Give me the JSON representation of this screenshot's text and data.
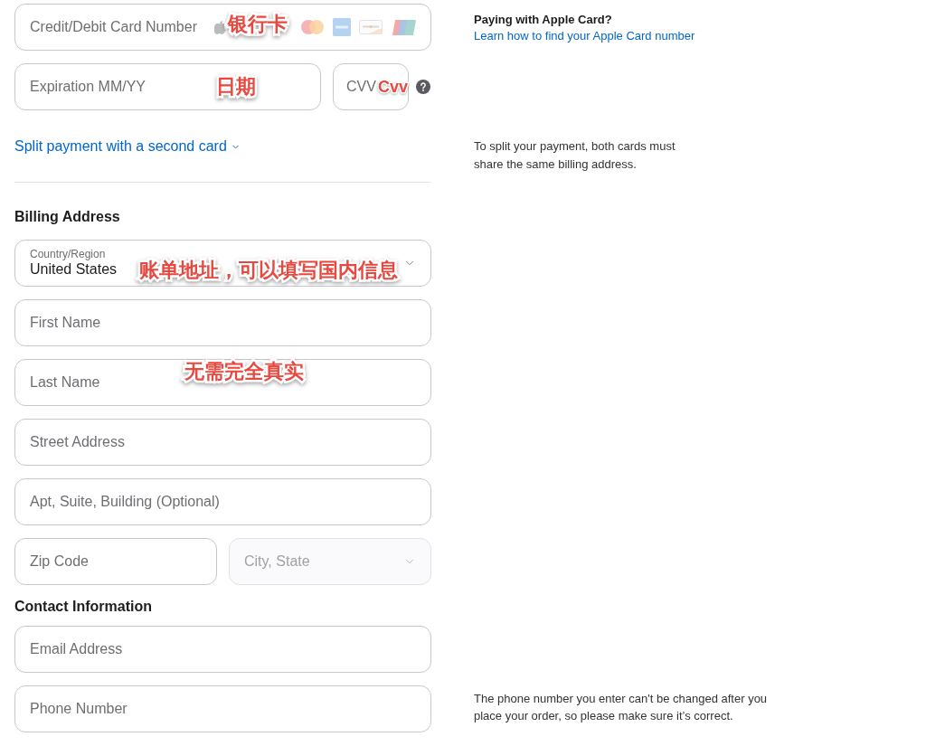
{
  "card_section": {
    "card_number": {
      "placeholder": "Credit/Debit Card Number",
      "annotation": "银行卡"
    },
    "apple_card": {
      "title": "Paying with Apple Card?",
      "link": "Learn how to find your Apple Card number"
    },
    "expiration": {
      "placeholder": "Expiration MM/YY",
      "annotation": "日期"
    },
    "cvv": {
      "placeholder": "CVV",
      "annotation": "Cvv"
    },
    "split_link": "Split payment with a second card",
    "split_note": "To split your payment, both cards must share the same billing address."
  },
  "billing_address": {
    "title": "Billing Address",
    "rows": [
      [
        {
          "kind": "select",
          "label": "Country/Region",
          "value": "United States",
          "disabled": false,
          "annotation": "账单地址，可以填写国内信息"
        }
      ],
      [
        {
          "kind": "input",
          "placeholder": "First Name",
          "disabled": false
        }
      ],
      [
        {
          "kind": "input",
          "placeholder": "Last Name",
          "disabled": false,
          "annotation": "无需完全真实"
        }
      ],
      [
        {
          "kind": "input",
          "placeholder": "Street Address",
          "disabled": false
        }
      ],
      [
        {
          "kind": "input",
          "placeholder": "Apt, Suite, Building (Optional)",
          "disabled": false
        }
      ],
      [
        {
          "kind": "input",
          "placeholder": "Zip Code",
          "disabled": false
        },
        {
          "kind": "select",
          "placeholder": "City, State",
          "disabled": true
        }
      ]
    ]
  },
  "contact_information": {
    "title": "Contact Information",
    "fields": [
      {
        "placeholder": "Email Address"
      },
      {
        "placeholder": "Phone Number",
        "note": "The phone number you enter can't be changed after you place your order, so please make sure it’s correct."
      }
    ]
  }
}
